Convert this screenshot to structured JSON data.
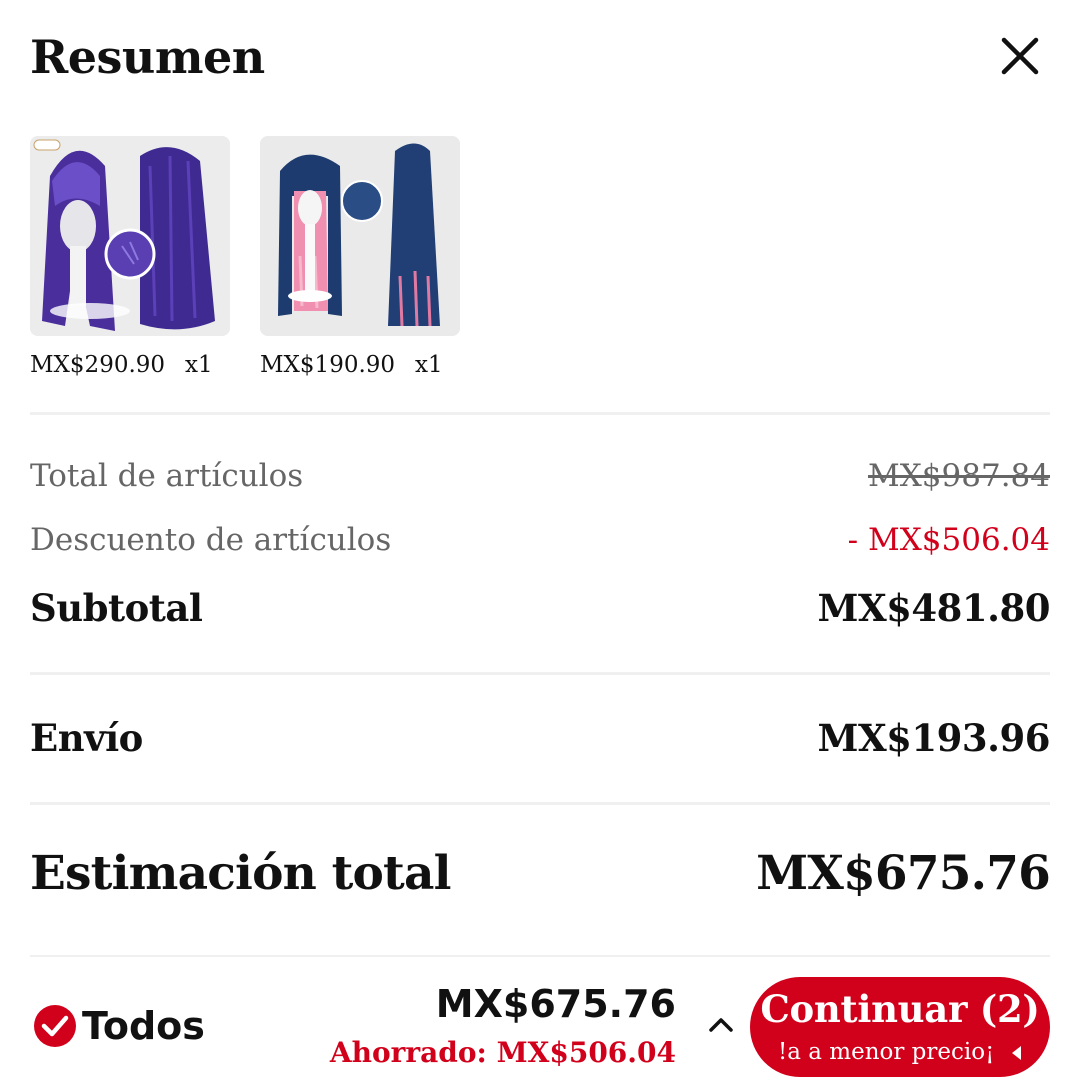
{
  "header": {
    "title": "Resumen",
    "close_icon": "close-icon"
  },
  "products": [
    {
      "price": "MX$290.90",
      "qty": "x1",
      "image": "purple-wig-image"
    },
    {
      "price": "MX$190.90",
      "qty": "x1",
      "image": "navy-pink-wig-image"
    }
  ],
  "summary": {
    "items_total_label": "Total de artículos",
    "items_total_value": "MX$987.84",
    "discount_label": "Descuento de artículos",
    "discount_value": "- MX$506.04",
    "subtotal_label": "Subtotal",
    "subtotal_value": "MX$481.80",
    "shipping_label": "Envío",
    "shipping_value": "MX$193.96",
    "estimate_label": "Estimación total",
    "estimate_value": "MX$675.76"
  },
  "footer": {
    "select_all_label": "Todos",
    "total": "MX$675.76",
    "saved": "Ahorrado: MX$506.04",
    "cta_label": "Continuar (2)",
    "cta_sub": "¡a a menor precio!"
  },
  "colors": {
    "accent": "#d1001b",
    "muted_text": "#666666",
    "divider": "#f0f0f0"
  }
}
